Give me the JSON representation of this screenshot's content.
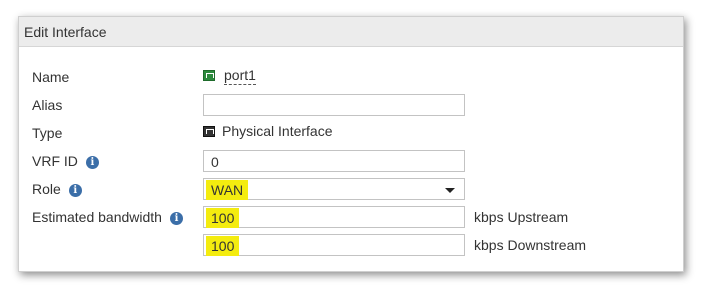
{
  "dialog": {
    "title": "Edit Interface",
    "highlight_color": "#f4ec0f"
  },
  "fields": {
    "name": {
      "label": "Name",
      "value": "port1",
      "icon": "port-icon"
    },
    "alias": {
      "label": "Alias",
      "value": ""
    },
    "type": {
      "label": "Type",
      "value": "Physical Interface",
      "icon": "physical-interface-icon"
    },
    "vrf_id": {
      "label": "VRF ID",
      "value": "0"
    },
    "role": {
      "label": "Role",
      "value": "WAN"
    },
    "bandwidth": {
      "label": "Estimated bandwidth",
      "upstream_value": "100",
      "upstream_unit": "kbps Upstream",
      "downstream_value": "100",
      "downstream_unit": "kbps Downstream"
    }
  }
}
